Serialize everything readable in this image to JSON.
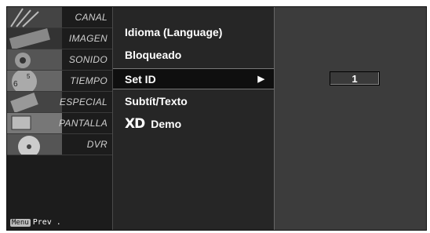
{
  "categories": [
    {
      "label": "CANAL",
      "icon": "antenna-icon"
    },
    {
      "label": "IMAGEN",
      "icon": "film-icon"
    },
    {
      "label": "SONIDO",
      "icon": "speaker-icon"
    },
    {
      "label": "TIEMPO",
      "icon": "clock-icon"
    },
    {
      "label": "ESPECIAL",
      "icon": "special-icon"
    },
    {
      "label": "PANTALLA",
      "icon": "screen-icon"
    },
    {
      "label": "DVR",
      "icon": "disc-icon"
    }
  ],
  "footer": {
    "key": "Menu",
    "text": "Prev ."
  },
  "menu": {
    "items": [
      {
        "label": "Idioma (Language)"
      },
      {
        "label": "Bloqueado"
      },
      {
        "label": "Set ID",
        "arrow": "▶"
      },
      {
        "label": "Subtít/Texto"
      },
      {
        "logo": "XD",
        "label": "Demo"
      }
    ]
  },
  "panel": {
    "set_id_value": "1"
  },
  "colors": {
    "background": "#262626",
    "selected": "#0f0f0f",
    "panel": "#3c3c3c",
    "text": "#ffffff"
  }
}
